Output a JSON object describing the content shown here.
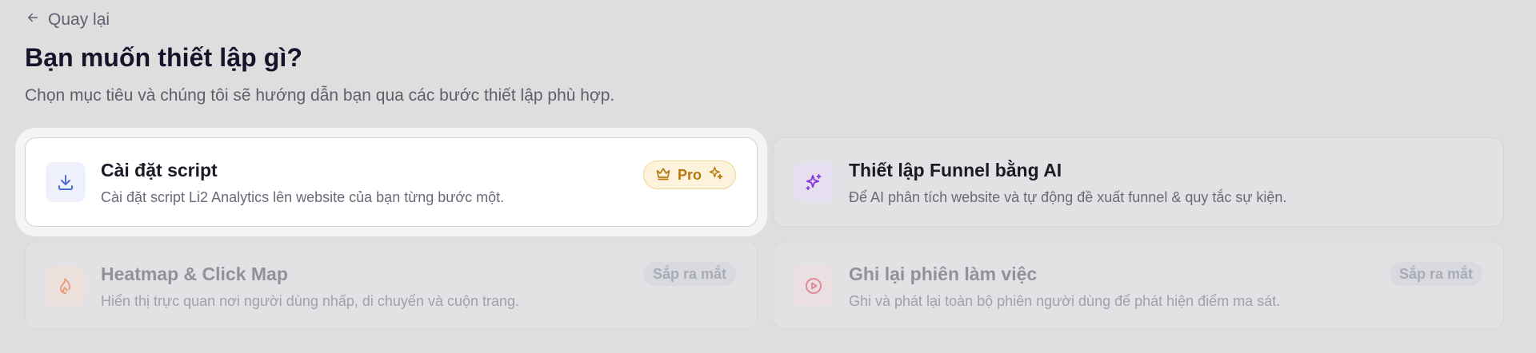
{
  "nav": {
    "back_label": "Quay lại"
  },
  "header": {
    "title": "Bạn muốn thiết lập gì?",
    "subtitle": "Chọn mục tiêu và chúng tôi sẽ hướng dẫn bạn qua các bước thiết lập phù hợp."
  },
  "options": [
    {
      "title": "Cài đặt script",
      "description": "Cài đặt script Li2 Analytics lên website của bạn từng bước một.",
      "icon": "download-icon",
      "badge": "Pro",
      "state": "selected"
    },
    {
      "title": "Thiết lập Funnel bằng AI",
      "description": "Để AI phân tích website và tự động đề xuất funnel & quy tắc sự kiện.",
      "icon": "sparkles-icon",
      "state": "available"
    },
    {
      "title": "Heatmap & Click Map",
      "description": "Hiển thị trực quan nơi người dùng nhấp, di chuyển và cuộn trang.",
      "icon": "flame-icon",
      "badge": "Sắp ra mắt",
      "state": "disabled"
    },
    {
      "title": "Ghi lại phiên làm việc",
      "description": "Ghi và phát lại toàn bộ phiên người dùng để phát hiện điểm ma sát.",
      "icon": "play-circle-icon",
      "badge": "Sắp ra mắt",
      "state": "disabled"
    }
  ],
  "colors": {
    "background": "#dededf",
    "accent_blue": "#4f6bd8",
    "accent_purple": "#8b3fd9",
    "pro_gold": "#b7790f",
    "flame_orange": "#e7a17a",
    "play_pink": "#e08a9b"
  }
}
